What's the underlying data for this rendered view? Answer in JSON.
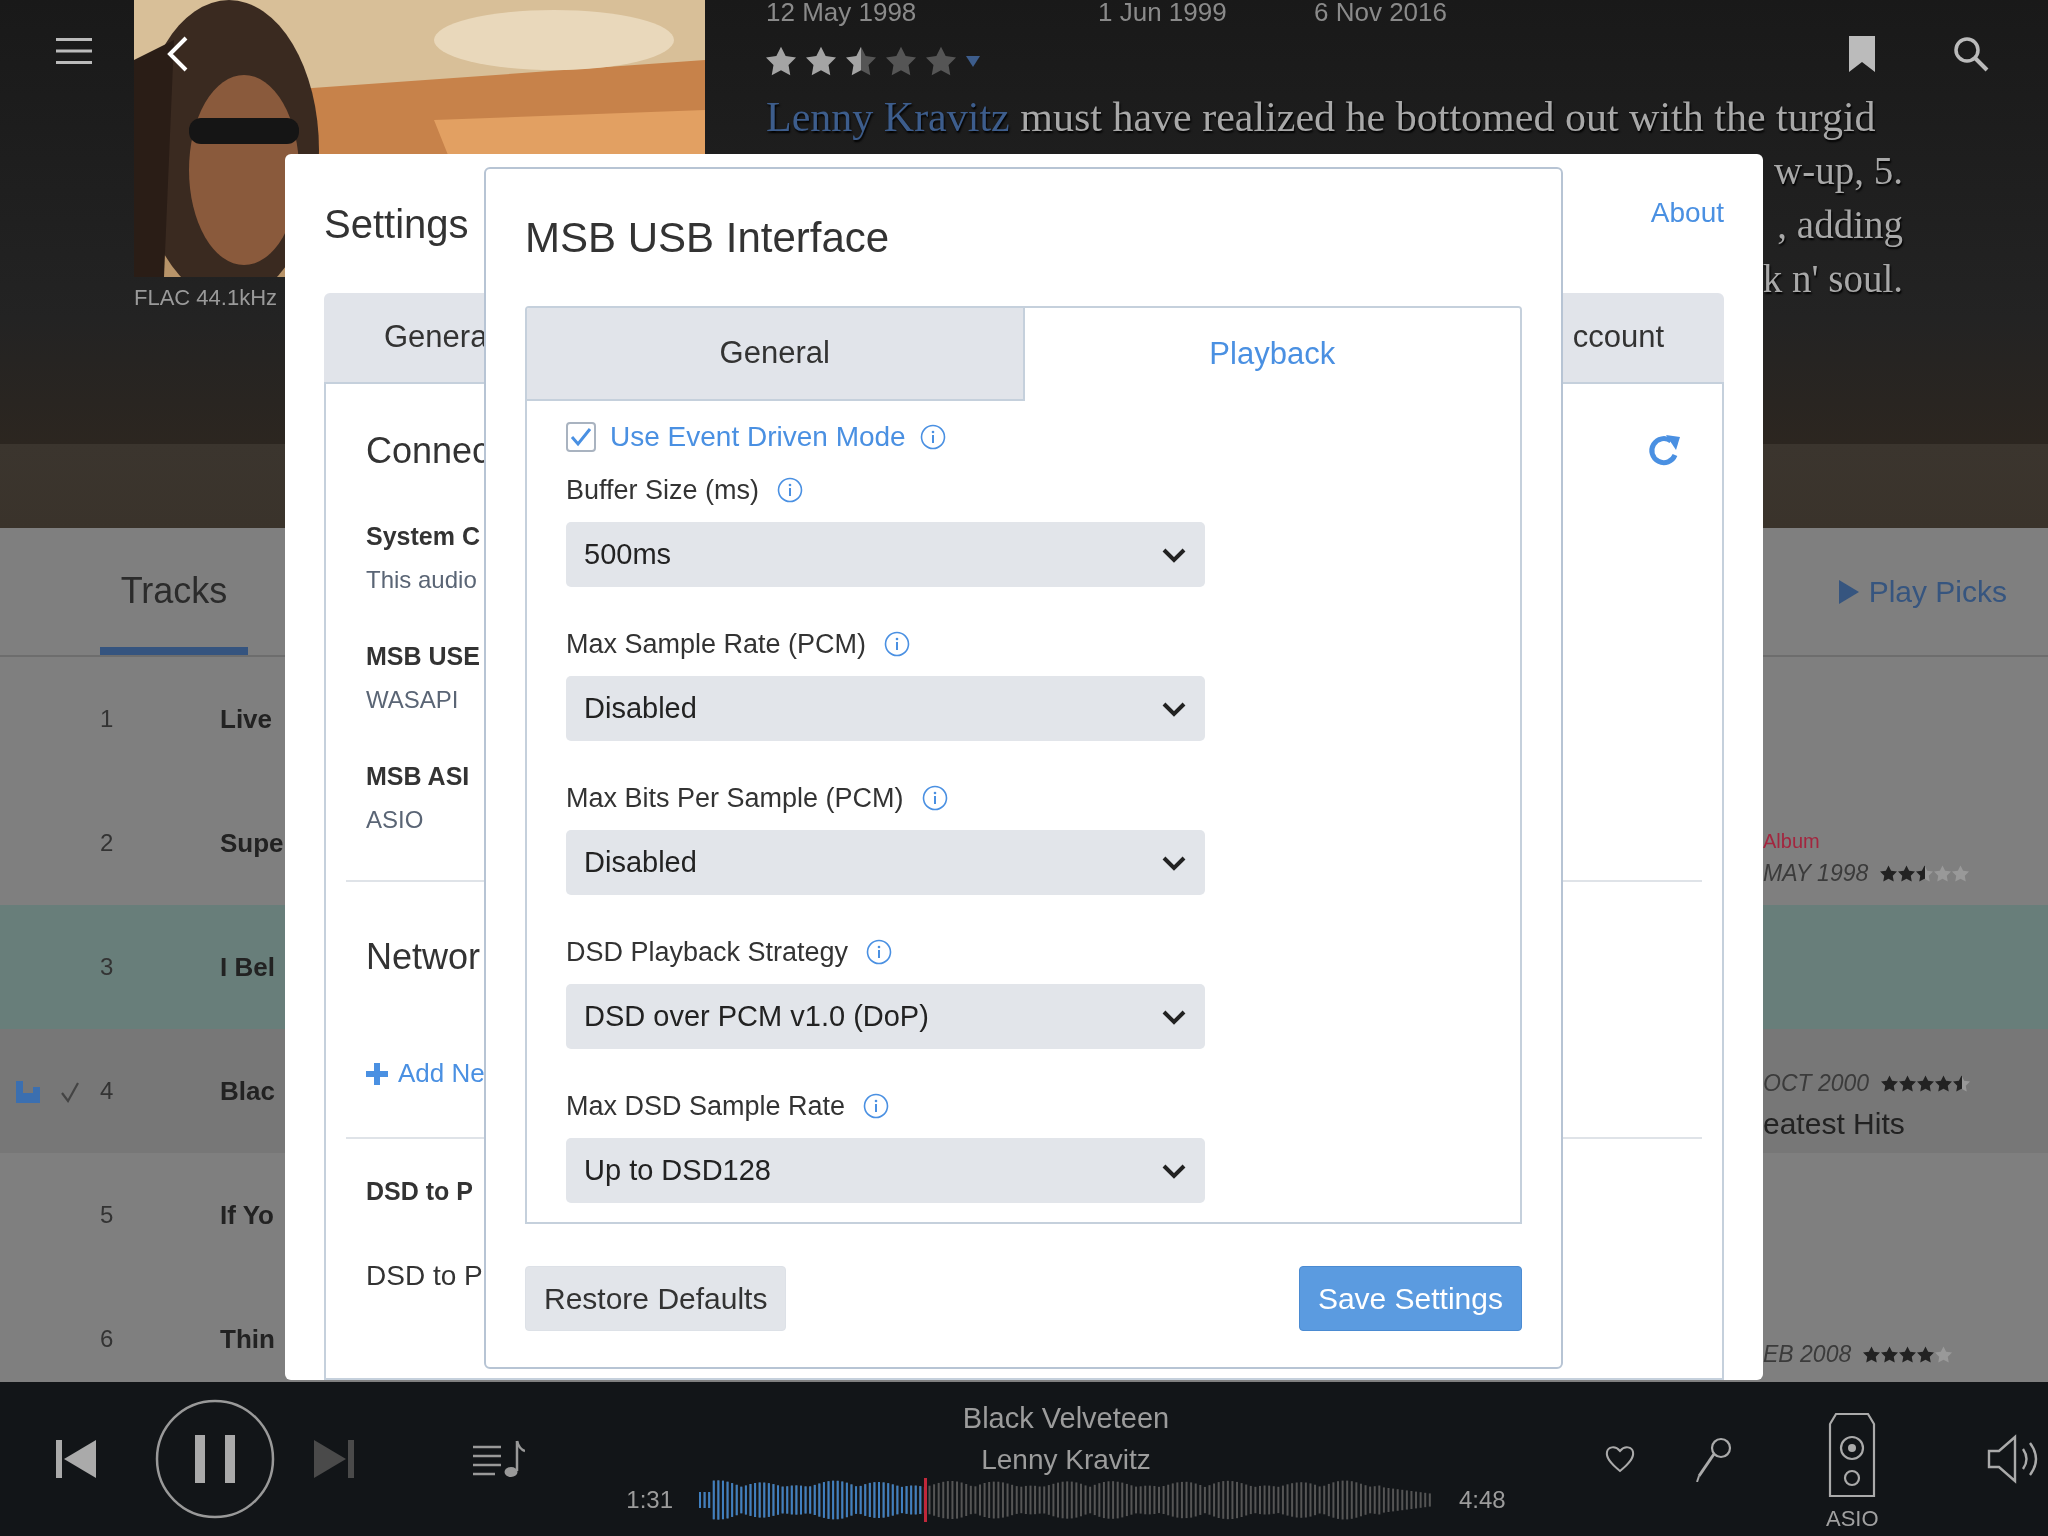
{
  "header": {
    "dates": [
      "12 May 1998",
      "1 Jun 1999",
      "6 Nov 2016"
    ],
    "stars": 2.5,
    "format": "FLAC 44.1kHz",
    "review": {
      "link": "Lenny Kravitz",
      "text": "must have realized he bottomed out with the turgid",
      "fragments": [
        "w-up, 5.",
        ", adding",
        "k n' soul."
      ]
    }
  },
  "tabs": [
    {
      "label": "Tracks",
      "selected": true
    }
  ],
  "play_picks": "Play Picks",
  "tracks": [
    {
      "number": "1",
      "title": "Live",
      "selected": false,
      "playing": false,
      "checked": false
    },
    {
      "number": "2",
      "title": "Supe",
      "selected": false,
      "playing": false,
      "checked": false,
      "side": {
        "label": "Album",
        "date": "MAY 1998",
        "stars": 2.5
      }
    },
    {
      "number": "3",
      "title": "I Bel",
      "selected": true,
      "playing": false,
      "checked": false
    },
    {
      "number": "4",
      "title": "Blac",
      "selected": false,
      "playing": true,
      "checked": true,
      "side": {
        "date": "OCT 2000",
        "stars": 4.5,
        "title": "eatest Hits"
      }
    },
    {
      "number": "5",
      "title": "If Yo",
      "selected": false,
      "playing": false,
      "checked": false
    },
    {
      "number": "6",
      "title": "Thin",
      "selected": false,
      "playing": false,
      "checked": false,
      "side": {
        "date": "EB 2008",
        "stars": 4
      }
    }
  ],
  "settings": {
    "title": "Settings",
    "about": "About",
    "tabs": [
      "Genera",
      "ccount"
    ],
    "sections": [
      {
        "kind": "devices",
        "title": "Connec",
        "items": [
          {
            "name": "System C",
            "detail": "This audio"
          },
          {
            "name": "MSB USE",
            "detail": "WASAPI"
          },
          {
            "name": "MSB ASI",
            "detail": "ASIO"
          }
        ]
      },
      {
        "kind": "add",
        "title": "Networ",
        "link": "Add Ne"
      },
      {
        "kind": "option",
        "name": "DSD to P",
        "detail": "DSD to P"
      }
    ]
  },
  "dialog": {
    "title": "MSB USB Interface",
    "tabs": [
      {
        "label": "General",
        "selected": false
      },
      {
        "label": "Playback",
        "selected": true
      }
    ],
    "checkbox": {
      "label": "Use Event Driven Mode",
      "checked": true
    },
    "fields": [
      {
        "label": "Buffer Size (ms)",
        "value": "500ms"
      },
      {
        "label": "Max Sample Rate (PCM)",
        "value": "Disabled"
      },
      {
        "label": "Max Bits Per Sample (PCM)",
        "value": "Disabled"
      },
      {
        "label": "DSD Playback Strategy",
        "value": "DSD over PCM v1.0 (DoP)"
      },
      {
        "label": "Max DSD Sample Rate",
        "value": "Up to DSD128"
      }
    ],
    "buttons": [
      {
        "label": "Restore Defaults",
        "kind": "secondary"
      },
      {
        "label": "Save Settings",
        "kind": "primary"
      }
    ]
  },
  "player": {
    "title": "Black Velveteen",
    "artist": "Lenny Kravitz",
    "elapsed": "1:31",
    "duration": "4:48",
    "level": 0.31,
    "playing": true,
    "output": "ASIO"
  }
}
